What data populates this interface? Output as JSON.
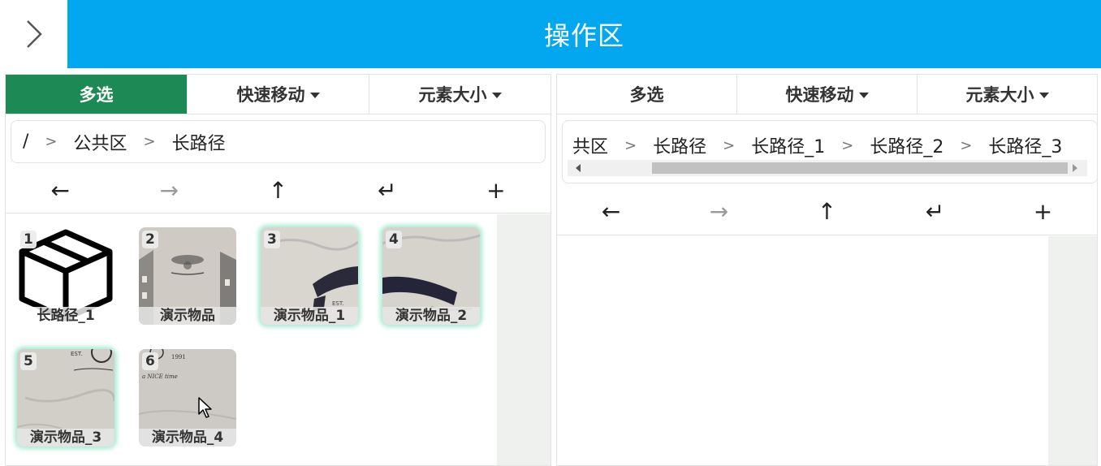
{
  "header": {
    "title": "操作区",
    "collapse_icon": "chevron-right-icon",
    "accent": "#02a7f0"
  },
  "left_panel": {
    "toolbar": {
      "multi_select": "多选",
      "quick_move": "快速移动",
      "element_size": "元素大小"
    },
    "breadcrumb": [
      "/",
      "公共区",
      "长路径"
    ],
    "nav": {
      "back": "←",
      "forward": "→",
      "up": "↑",
      "enter": "↵",
      "add": "+"
    },
    "items": [
      {
        "number": "1",
        "label": "长路径_1",
        "kind": "folder",
        "selected": false
      },
      {
        "number": "2",
        "label": "演示物品",
        "kind": "image",
        "selected": false
      },
      {
        "number": "3",
        "label": "演示物品_1",
        "kind": "image",
        "selected": true
      },
      {
        "number": "4",
        "label": "演示物品_2",
        "kind": "image",
        "selected": true
      },
      {
        "number": "5",
        "label": "演示物品_3",
        "kind": "image",
        "selected": true
      },
      {
        "number": "6",
        "label": "演示物品_4",
        "kind": "image",
        "selected": false
      }
    ]
  },
  "right_panel": {
    "toolbar": {
      "multi_select": "多选",
      "quick_move": "快速移动",
      "element_size": "元素大小"
    },
    "breadcrumb": [
      "共区",
      "长路径",
      "长路径_1",
      "长路径_2",
      "长路径_3"
    ],
    "nav": {
      "back": "←",
      "forward": "→",
      "up": "↑",
      "enter": "↵",
      "add": "+"
    }
  },
  "colors": {
    "active_tab": "#1d8a55",
    "selection_glow": "#a8ead2"
  }
}
